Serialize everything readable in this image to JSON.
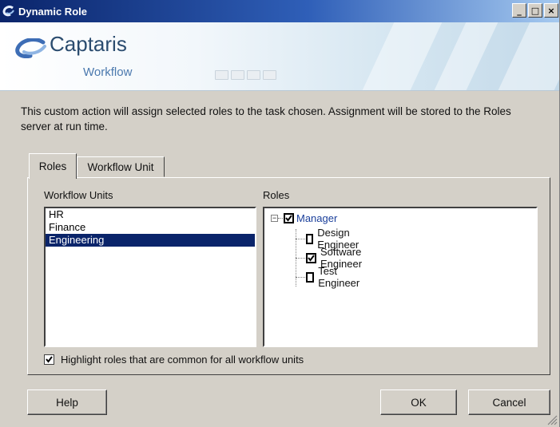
{
  "window": {
    "title": "Dynamic Role"
  },
  "title_buttons": [
    {
      "name": "minimize",
      "glyph": "_"
    },
    {
      "name": "maximize",
      "glyph": "□"
    },
    {
      "name": "close",
      "glyph": "×"
    }
  ],
  "banner": {
    "logo_text": "Captaris",
    "logo_sub": "Workflow",
    "brand_color": "#2b4c6f"
  },
  "description": "This custom action will assign selected roles to the task chosen. Assignment will be stored to the Roles server at run time.",
  "tabs": [
    {
      "label": "Roles",
      "active": true
    },
    {
      "label": "Workflow Unit",
      "active": false
    }
  ],
  "workflow_units": {
    "label": "Workflow Units",
    "items": [
      {
        "label": "HR",
        "selected": false
      },
      {
        "label": "Finance",
        "selected": false
      },
      {
        "label": "Engineering",
        "selected": true
      }
    ]
  },
  "roles": {
    "label": "Roles",
    "root": {
      "label": "Manager",
      "checked": true,
      "expanded": true,
      "color": "#1a3f9b"
    },
    "children": [
      {
        "label": "Design Engineer",
        "checked": false
      },
      {
        "label": "Software Engineer",
        "checked": true
      },
      {
        "label": "Test Engineer",
        "checked": false
      }
    ]
  },
  "highlight_option": {
    "label": "Highlight roles that are common for all workflow units",
    "checked": true
  },
  "buttons": {
    "help": "Help",
    "ok": "OK",
    "cancel": "Cancel"
  },
  "colors": {
    "title_bar": "#0a246a",
    "selection": "#0a246a",
    "face": "#d4d0c8"
  }
}
